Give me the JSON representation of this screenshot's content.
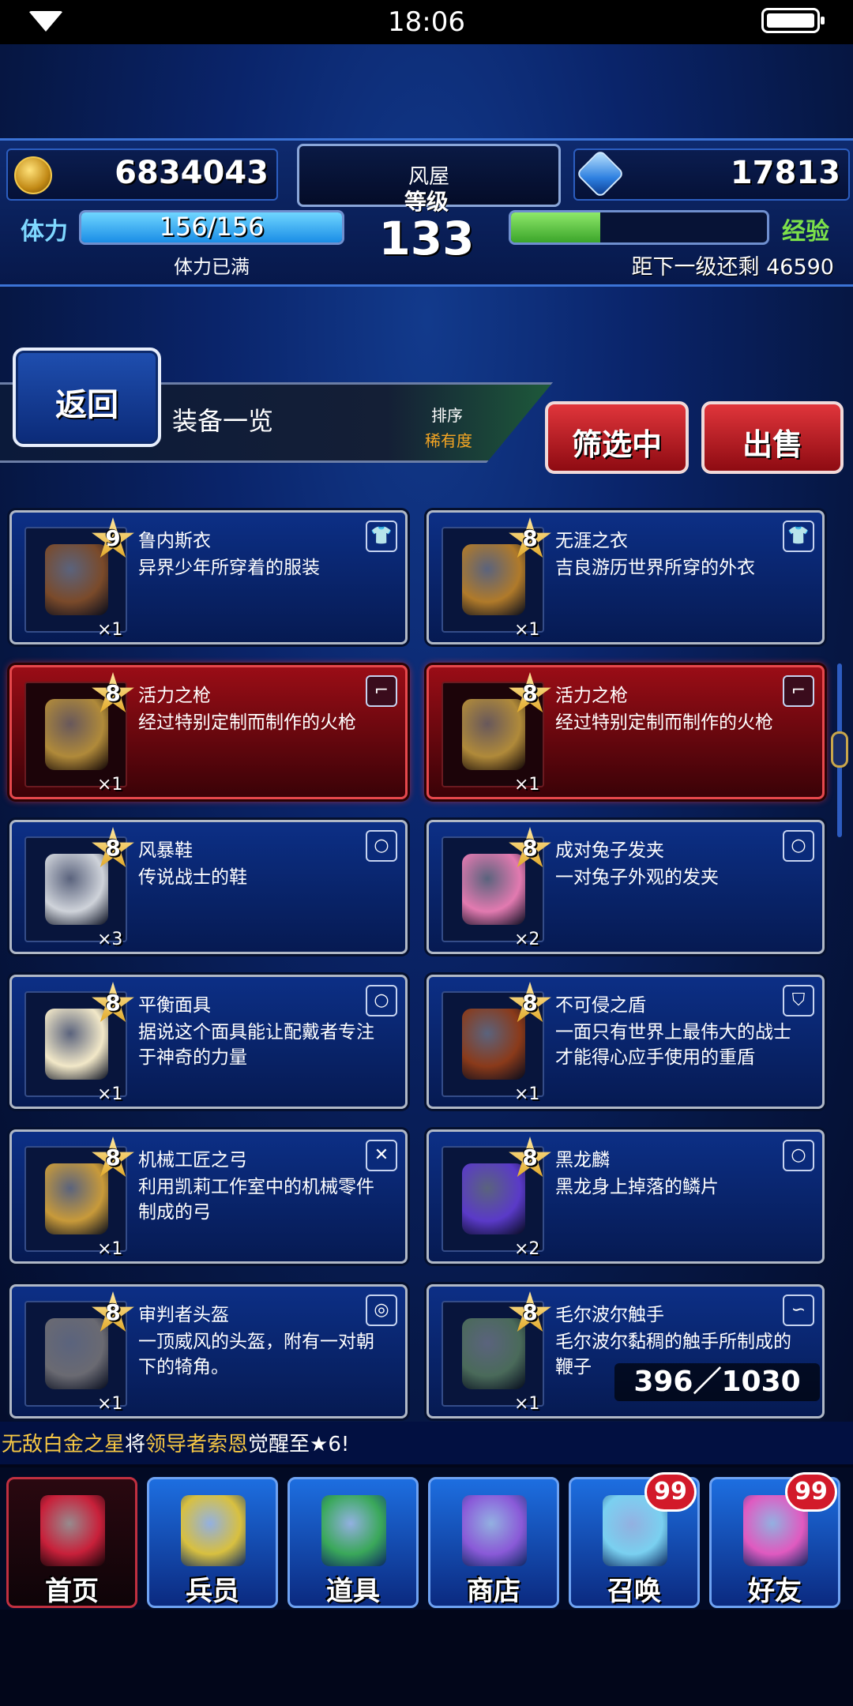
{
  "status_bar": {
    "time": "18:06"
  },
  "header": {
    "gold": "6834043",
    "gems": "17813",
    "player_name": "风屋",
    "level_label": "等级",
    "level": "133",
    "stamina_label": "体力",
    "stamina_value": "156/156",
    "stamina_fraction": 1.0,
    "stamina_status": "体力已满",
    "exp_label": "经验",
    "exp_fraction": 0.35,
    "exp_next": "距下一级还剩 46590"
  },
  "nav": {
    "back": "返回",
    "title": "装备一览",
    "sort_label": "排序",
    "sort_value": "稀有度",
    "filter": "筛选中",
    "sell": "出售"
  },
  "items": [
    {
      "name": "鲁内斯衣",
      "desc": "异界少年所穿着的服装",
      "rarity": "9",
      "qty": "×1",
      "type_icon": "armor-icon",
      "highlight": false,
      "art_color": "#7a4a2a"
    },
    {
      "name": "无涯之衣",
      "desc": "吉良游历世界所穿的外衣",
      "rarity": "8",
      "qty": "×1",
      "type_icon": "armor-icon",
      "highlight": false,
      "art_color": "#b07a2a"
    },
    {
      "name": "活力之枪",
      "desc": "经过特别定制而制作的火枪",
      "rarity": "8",
      "qty": "×1",
      "type_icon": "gun-icon",
      "highlight": true,
      "art_color": "#b08a3a"
    },
    {
      "name": "活力之枪",
      "desc": "经过特别定制而制作的火枪",
      "rarity": "8",
      "qty": "×1",
      "type_icon": "gun-icon",
      "highlight": true,
      "art_color": "#b08a3a"
    },
    {
      "name": "风暴鞋",
      "desc": "传说战士的鞋",
      "rarity": "8",
      "qty": "×3",
      "type_icon": "accessory-icon",
      "highlight": false,
      "art_color": "#cfd3da"
    },
    {
      "name": "成对兔子发夹",
      "desc": "一对兔子外观的发夹",
      "rarity": "8",
      "qty": "×2",
      "type_icon": "accessory-icon",
      "highlight": false,
      "art_color": "#e27ab0"
    },
    {
      "name": "平衡面具",
      "desc": "据说这个面具能让配戴者专注于神奇的力量",
      "rarity": "8",
      "qty": "×1",
      "type_icon": "accessory-icon",
      "highlight": false,
      "art_color": "#f2e8c8"
    },
    {
      "name": "不可侵之盾",
      "desc": "一面只有世界上最伟大的战士才能得心应手使用的重盾",
      "rarity": "8",
      "qty": "×1",
      "type_icon": "shield-icon",
      "highlight": false,
      "art_color": "#8a3a1a"
    },
    {
      "name": "机械工匠之弓",
      "desc": "利用凯莉工作室中的机械零件制成的弓",
      "rarity": "8",
      "qty": "×1",
      "type_icon": "bow-icon",
      "highlight": false,
      "art_color": "#c89a3a"
    },
    {
      "name": "黑龙麟",
      "desc": "黑龙身上掉落的鳞片",
      "rarity": "8",
      "qty": "×2",
      "type_icon": "accessory-icon",
      "highlight": false,
      "art_color": "#5a3ac8"
    },
    {
      "name": "审判者头盔",
      "desc": "一顶威风的头盔，附有一对朝下的犄角。",
      "rarity": "8",
      "qty": "×1",
      "type_icon": "helmet-icon",
      "highlight": false,
      "art_color": "#6a6a72"
    },
    {
      "name": "毛尔波尔触手",
      "desc": "毛尔波尔黏稠的触手所制成的鞭子",
      "rarity": "8",
      "qty": "×1",
      "type_icon": "whip-icon",
      "highlight": false,
      "art_color": "#4a6a5a"
    }
  ],
  "inventory_count": "396／1030",
  "ticker": {
    "part1": "无敌白金之星",
    "part2": "将",
    "part3": "领导者索恩",
    "part4": "觉醒至★6!"
  },
  "tabs": [
    {
      "label": "首页",
      "badge": "",
      "active": true,
      "art_color": "#c8203a"
    },
    {
      "label": "兵员",
      "badge": "",
      "active": false,
      "art_color": "#d8c040"
    },
    {
      "label": "道具",
      "badge": "",
      "active": false,
      "art_color": "#3aa85a"
    },
    {
      "label": "商店",
      "badge": "",
      "active": false,
      "art_color": "#8a5ad8"
    },
    {
      "label": "召唤",
      "badge": "99",
      "active": false,
      "art_color": "#7ad0f0"
    },
    {
      "label": "好友",
      "badge": "99",
      "active": false,
      "art_color": "#e05ac0"
    }
  ],
  "colors": {
    "accent_blue": "#1a8de6",
    "exp_green": "#3ba52a",
    "alert_red": "#d21a2a",
    "sort_orange": "#f6a623"
  }
}
